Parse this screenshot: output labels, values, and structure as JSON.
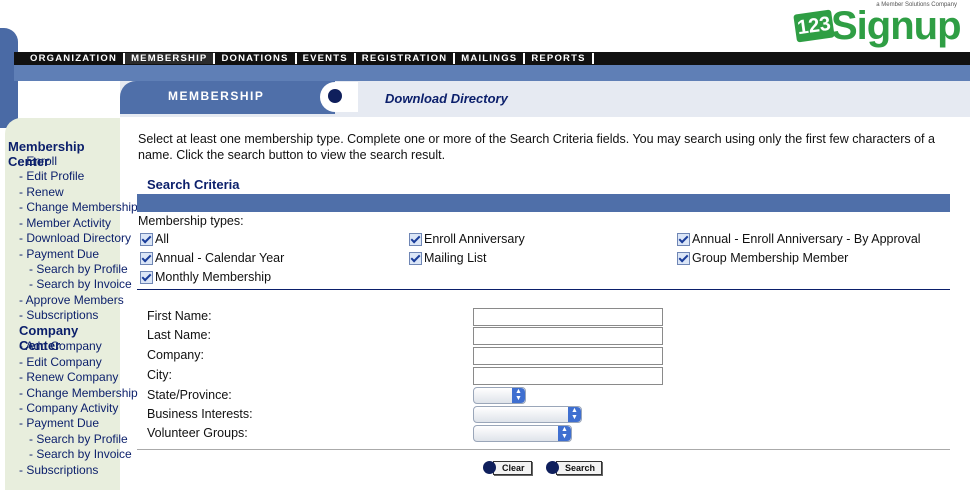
{
  "logo": {
    "number": "123",
    "word": "Signup",
    "tagline": "a Member Solutions Company"
  },
  "nav": [
    {
      "label": "Organization",
      "active": false
    },
    {
      "label": "Membership",
      "active": true
    },
    {
      "label": "Donations",
      "active": false
    },
    {
      "label": "Events",
      "active": false
    },
    {
      "label": "Registration",
      "active": false
    },
    {
      "label": "Mailings",
      "active": false
    },
    {
      "label": "Reports",
      "active": false
    }
  ],
  "module": {
    "title": "Membership",
    "page_title": "Download Directory"
  },
  "sidebar": {
    "membership_head": "Membership Center",
    "membership_items": [
      "- Enroll",
      "- Edit Profile",
      "- Renew",
      "- Change Membership",
      "- Member Activity",
      "- Download Directory",
      "- Payment Due",
      "- Search by Profile",
      "- Search by Invoice",
      "- Approve Members",
      "- Subscriptions"
    ],
    "company_head": "Company Center",
    "company_items": [
      "- Add Company",
      "- Edit Company",
      "- Renew Company",
      "- Change Membership",
      "- Company Activity",
      "- Payment Due",
      "- Search by Profile",
      "- Search by Invoice",
      "- Subscriptions"
    ]
  },
  "intro": "Select at least one membership type. Complete one or more of the Search Criteria fields. You may search using only the first few characters of a name. Click the search button to view the search result.",
  "search_criteria": {
    "title": "Search Criteria",
    "membership_types_label": "Membership types:",
    "types": [
      {
        "label": "All",
        "checked": true
      },
      {
        "label": "Enroll Anniversary",
        "checked": true
      },
      {
        "label": "Annual - Enroll Anniversary - By Approval",
        "checked": true
      },
      {
        "label": "Annual - Calendar Year",
        "checked": true
      },
      {
        "label": "Mailing List",
        "checked": true
      },
      {
        "label": "Group Membership Member",
        "checked": true
      },
      {
        "label": "Monthly Membership",
        "checked": true
      }
    ]
  },
  "fields": {
    "first_name": {
      "label": "First Name:",
      "value": ""
    },
    "last_name": {
      "label": "Last Name:",
      "value": ""
    },
    "company": {
      "label": "Company:",
      "value": ""
    },
    "city": {
      "label": "City:",
      "value": ""
    },
    "state": {
      "label": "State/Province:",
      "value": ""
    },
    "business_interests": {
      "label": "Business Interests:",
      "value": ""
    },
    "volunteer_groups": {
      "label": "Volunteer Groups:",
      "value": ""
    }
  },
  "buttons": {
    "clear": "Clear",
    "search": "Search"
  }
}
